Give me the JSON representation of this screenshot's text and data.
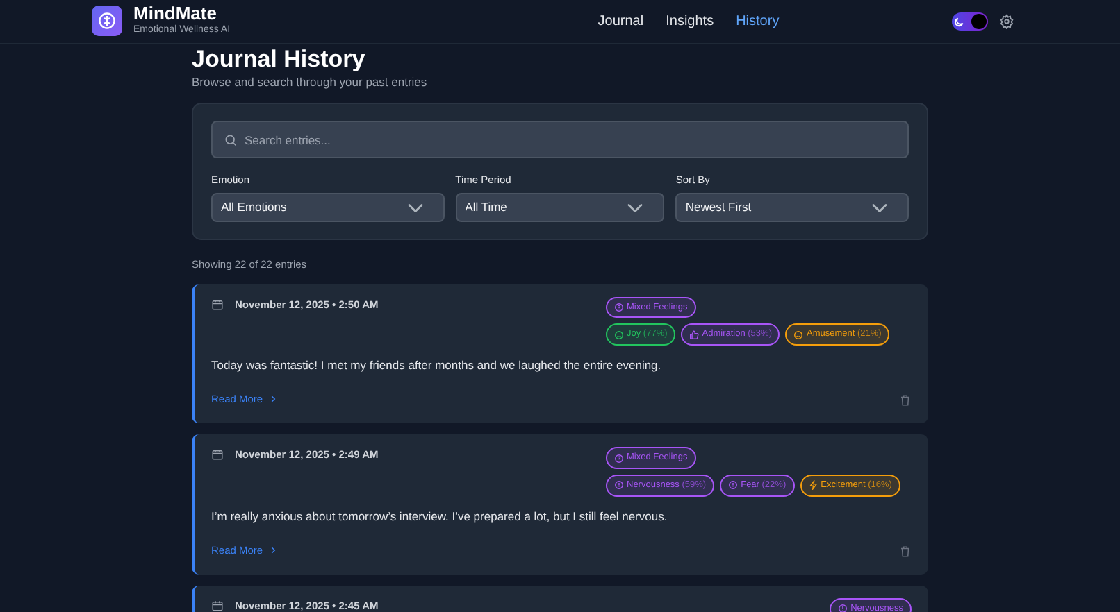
{
  "brand": {
    "name": "MindMate",
    "tagline": "Emotional Wellness AI"
  },
  "nav": [
    {
      "label": "Journal",
      "selected": false
    },
    {
      "label": "Insights",
      "selected": false
    },
    {
      "label": "History",
      "selected": true
    }
  ],
  "dark_mode": {
    "on": true
  },
  "page": {
    "title": "Journal History",
    "subtitle": "Browse and search through your past entries"
  },
  "filters": {
    "search": {
      "placeholder": "Search entries..."
    },
    "selects": [
      {
        "label": "Emotion",
        "value": "All Emotions"
      },
      {
        "label": "Time Period",
        "value": "All Time"
      },
      {
        "label": "Sort By",
        "value": "Newest First"
      }
    ]
  },
  "count": "Showing 22 of 22 entries",
  "entries": [
    {
      "date": "November 12, 2025 • 2:50 AM",
      "summary": {
        "label": "Mixed Feelings",
        "kind": "question",
        "color": "#a855f7"
      },
      "emotions": [
        {
          "name": "Joy",
          "pct": "(77%)",
          "kind": "smile",
          "color": "#22c55e"
        },
        {
          "name": "Admiration",
          "pct": "(53%)",
          "kind": "thumb",
          "color": "#a855f7"
        },
        {
          "name": "Amusement",
          "pct": "(21%)",
          "kind": "smile",
          "color": "#f59e0b"
        }
      ],
      "text": "Today was fantastic! I met my friends after months and we laughed the entire evening.",
      "link": "Read More"
    },
    {
      "date": "November 12, 2025 • 2:49 AM",
      "summary": {
        "label": "Mixed Feelings",
        "kind": "question",
        "color": "#a855f7"
      },
      "emotions": [
        {
          "name": "Nervousness",
          "pct": "(59%)",
          "kind": "alert",
          "color": "#a855f7"
        },
        {
          "name": "Fear",
          "pct": "(22%)",
          "kind": "alert",
          "color": "#a855f7"
        },
        {
          "name": "Excitement",
          "pct": "(16%)",
          "kind": "bolt",
          "color": "#f59e0b"
        }
      ],
      "text": "I’m really anxious about tomorrow’s interview. I’ve prepared a lot, but I still feel nervous.",
      "link": "Read More"
    },
    {
      "date": "November 12, 2025 • 2:45 AM",
      "summary": {
        "label": "Nervousness",
        "kind": "alert",
        "color": "#a855f7"
      }
    }
  ]
}
